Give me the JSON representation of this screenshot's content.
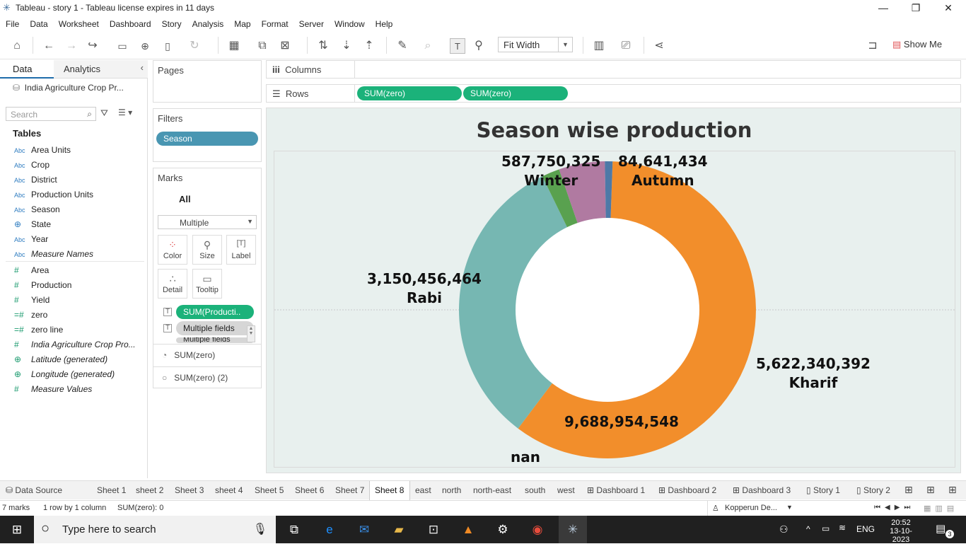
{
  "window": {
    "title": "Tableau - story 1 - Tableau license expires in 11 days"
  },
  "menu": [
    "File",
    "Data",
    "Worksheet",
    "Dashboard",
    "Story",
    "Analysis",
    "Map",
    "Format",
    "Server",
    "Window",
    "Help"
  ],
  "toolbar": {
    "fit": "Fit Width",
    "show_me": "Show Me"
  },
  "data_pane": {
    "tab_data": "Data",
    "tab_analytics": "Analytics",
    "datasource": "India Agriculture Crop Pr...",
    "search_placeholder": "Search",
    "tables_header": "Tables",
    "dimensions": [
      {
        "type": "Abc",
        "name": "Area Units"
      },
      {
        "type": "Abc",
        "name": "Crop"
      },
      {
        "type": "Abc",
        "name": "District"
      },
      {
        "type": "Abc",
        "name": "Production Units"
      },
      {
        "type": "Abc",
        "name": "Season"
      },
      {
        "type": "globe",
        "name": "State"
      },
      {
        "type": "Abc",
        "name": "Year"
      },
      {
        "type": "Abc",
        "name": "Measure Names"
      }
    ],
    "measures": [
      {
        "type": "#",
        "name": "Area"
      },
      {
        "type": "#",
        "name": "Production"
      },
      {
        "type": "#",
        "name": "Yield"
      },
      {
        "type": "=#",
        "name": "zero"
      },
      {
        "type": "=#",
        "name": "zero line"
      },
      {
        "type": "#",
        "name": "India Agriculture Crop Pro..."
      },
      {
        "type": "globe",
        "name": "Latitude (generated)"
      },
      {
        "type": "globe",
        "name": "Longitude (generated)"
      },
      {
        "type": "#",
        "name": "Measure Values"
      }
    ]
  },
  "pages": {
    "label": "Pages"
  },
  "filters": {
    "label": "Filters",
    "pill": "Season"
  },
  "marks": {
    "label": "Marks",
    "all": "All",
    "type": "Multiple",
    "buttons": [
      "Color",
      "Size",
      "Label",
      "Detail",
      "Tooltip"
    ],
    "pills": [
      "SUM(Producti..",
      "Multiple fields",
      "Multiple fields"
    ],
    "layers": [
      "SUM(zero)",
      "SUM(zero) (2)"
    ]
  },
  "shelves": {
    "columns_label": "Columns",
    "rows_label": "Rows",
    "rows_pills": [
      "SUM(zero)",
      "SUM(zero)"
    ]
  },
  "viz": {
    "title": "Season wise production",
    "labels": {
      "kharif_value": "5,622,340,392",
      "kharif_name": "Kharif",
      "rabi_value": "3,150,456,464",
      "rabi_name": "Rabi",
      "winter_value": "587,750,325",
      "winter_name": "Winter",
      "autumn_value": "84,641,434",
      "autumn_name": "Autumn",
      "total_value": "9,688,954,548",
      "nan_name": "nan"
    },
    "colors": {
      "kharif": "#f28e2b",
      "rabi": "#76b7b2",
      "winter": "#59a14f",
      "summer_whole": "#b07aa1",
      "autumn": "#4e79a7"
    }
  },
  "sheet_tabs": [
    "Data Source",
    "Sheet 1",
    "sheet 2",
    "Sheet 3",
    "sheet 4",
    "Sheet 5",
    "Sheet 6",
    "Sheet 7",
    "Sheet 8",
    "east",
    "north",
    "north-east",
    "south",
    "west",
    "Dashboard 1",
    "Dashboard 2",
    "Dashboard 3",
    "Story 1",
    "Story 2"
  ],
  "active_tab": "Sheet 8",
  "status": {
    "marks": "7 marks",
    "rows_cols": "1 row by 1 column",
    "sum": "SUM(zero): 0",
    "user": "Kopperun De..."
  },
  "taskbar": {
    "search_placeholder": "Type here to search",
    "lang": "ENG",
    "time": "20:52",
    "date": "13-10-2023",
    "notif_count": "3"
  }
}
